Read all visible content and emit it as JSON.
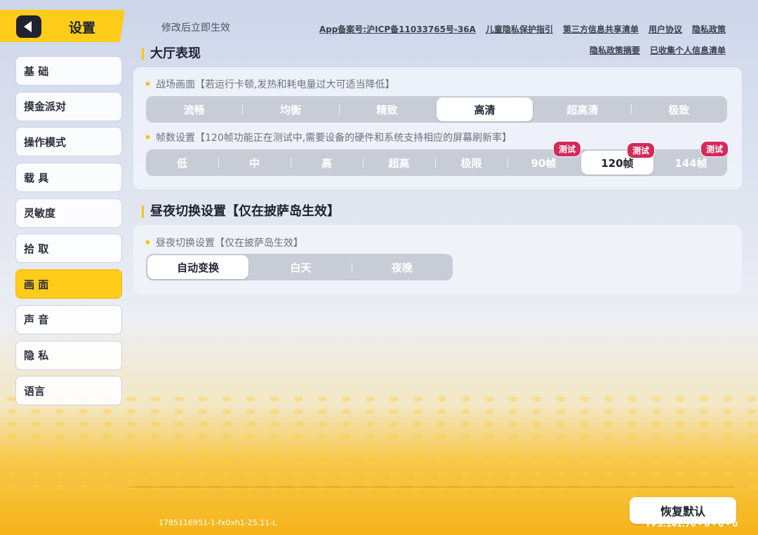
{
  "header": {
    "title": "设置",
    "notice": "修改后立即生效"
  },
  "links": {
    "row1": [
      "App备案号:沪ICP备11033765号-36A",
      "儿童隐私保护指引",
      "第三方信息共享清单",
      "用户协议",
      "隐私政策"
    ],
    "row2": [
      "隐私政策摘要",
      "已收集个人信息清单"
    ]
  },
  "sidebar": {
    "items": [
      {
        "label": "基 础"
      },
      {
        "label": "摸金派对"
      },
      {
        "label": "操作模式"
      },
      {
        "label": "载 具"
      },
      {
        "label": "灵敏度"
      },
      {
        "label": "拾 取"
      },
      {
        "label": "画 面"
      },
      {
        "label": "声 音"
      },
      {
        "label": "隐 私"
      },
      {
        "label": "语言"
      }
    ],
    "active_index": 6
  },
  "lobby": {
    "heading": "大厅表现",
    "quality": {
      "label": "战场画面【若运行卡顿,发热和耗电量过大可适当降低】",
      "options": [
        "流畅",
        "均衡",
        "精致",
        "高清",
        "超高清",
        "极致"
      ],
      "selected": "高清"
    },
    "framerate": {
      "label": "帧数设置【120帧功能正在测试中,需要设备的硬件和系统支持相应的屏幕刷新率】",
      "options": [
        "低",
        "中",
        "高",
        "超高",
        "极限",
        "90帧",
        "120帧",
        "144帧"
      ],
      "selected": "120帧",
      "badge": "测试"
    }
  },
  "daynight": {
    "heading": "昼夜切换设置【仅在披萨岛生效】",
    "label": "昼夜切换设置【仅在披萨岛生效】",
    "options": [
      "自动变换",
      "白天",
      "夜晚"
    ],
    "selected": "自动变换"
  },
  "footer": {
    "reset_label": "恢复默认",
    "build": "1785116951-1-fx0xh1-25.11-L",
    "fps": "FPS:141.76 - 6 - 0 - 0"
  },
  "colors": {
    "accent": "#ffcc1a",
    "badge": "#d32a5a"
  }
}
